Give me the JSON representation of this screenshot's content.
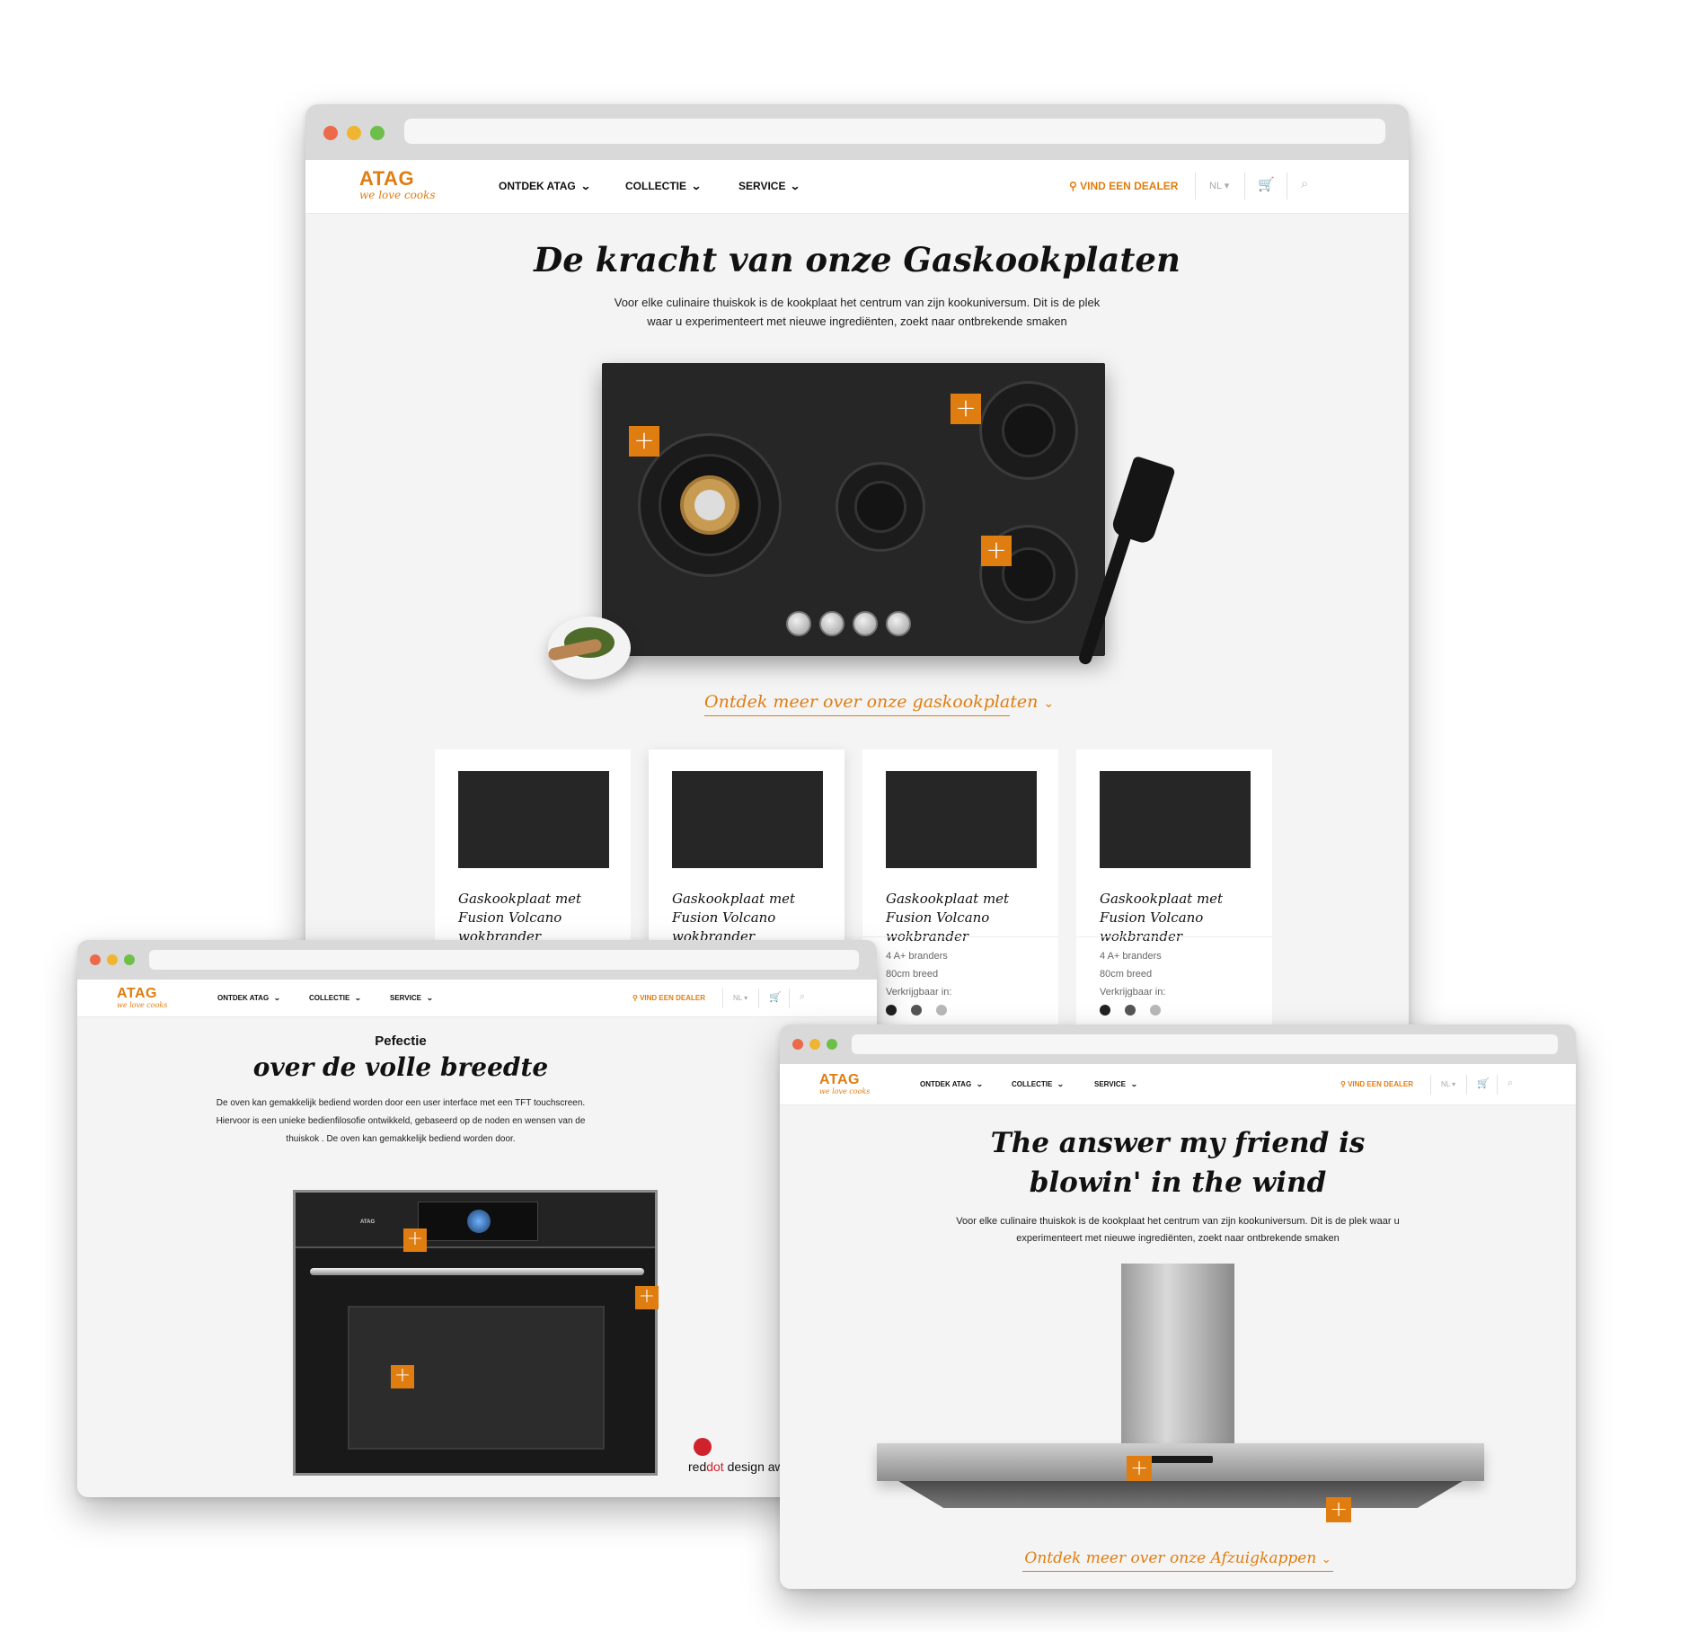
{
  "nav": {
    "logo": "ATAG",
    "tagline": "we love cooks",
    "ontdek": "ONTDEK ATAG",
    "collectie": "COLLECTIE",
    "service": "SERVICE",
    "dealer": "VIND EEN DEALER",
    "lang": "NL"
  },
  "hob_page": {
    "title": "De kracht van onze Gaskookplaten",
    "intro": "Voor elke culinaire thuiskok is de kookplaat het centrum van zijn kookuniversum. Dit is de plek waar u experimenteert met nieuwe ingrediënten, zoekt naar ontbrekende smaken",
    "cta": "Ontdek meer over onze gaskookplaten",
    "products": [
      {
        "title": "Gaskookplaat met Fusion Volcano wokbrander"
      },
      {
        "title": "Gaskookplaat met Fusion Volcano wokbrander"
      },
      {
        "title": "Gaskookplaat met Fusion Volcano wokbrander",
        "spec1": "4 A+ branders",
        "spec2": "80cm breed",
        "spec3": "Verkrijgbaar in:"
      },
      {
        "title": "Gaskookplaat met Fusion Volcano wokbrander",
        "spec1": "4 A+ branders",
        "spec2": "80cm breed",
        "spec3": "Verkrijgbaar in:"
      }
    ],
    "swatch_colors": [
      "#222222",
      "#555555",
      "#b8b8b8"
    ]
  },
  "oven_page": {
    "kicker": "Pefectie",
    "title": "over de volle breedte",
    "intro": "De oven kan gemakkelijk bediend worden door een user interface met een TFT touchscreen. Hiervoor is een unieke bedienfilosofie ontwikkeld, gebaseerd op de noden en wensen van de thuiskok . De oven kan gemakkelijk bediend worden door.",
    "award_red": "red",
    "award_dot": "dot",
    "award_rest": "design awa",
    "oven_brand": "ATAG"
  },
  "hood_page": {
    "title": "The answer my friend is blowin' in the wind",
    "intro": "Voor elke culinaire thuiskok is de kookplaat het centrum van zijn kookuniversum. Dit is de plek waar u experimenteert met nieuwe ingrediënten, zoekt naar ontbrekende smaken",
    "cta": "Ontdek meer over onze Afzuigkappen"
  },
  "icons": [
    "location-pin-icon",
    "chevron-down-icon",
    "cart-icon",
    "search-icon",
    "plus-hotspot-icon"
  ],
  "accent_color": "#e07d10"
}
